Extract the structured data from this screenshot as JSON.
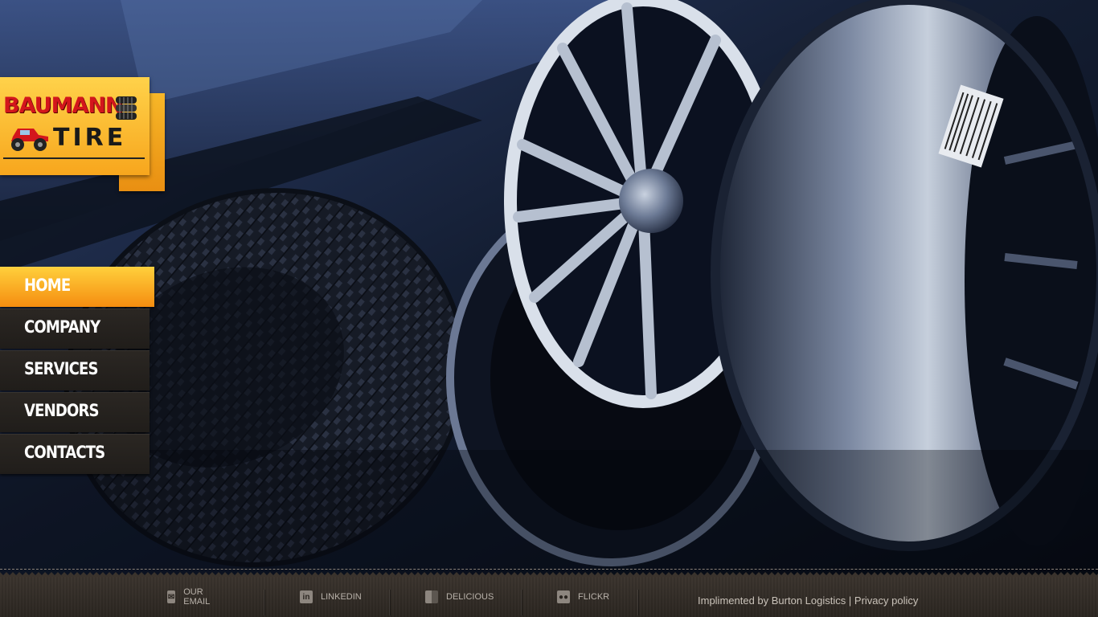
{
  "logo": {
    "line1": "BAUMANN",
    "line2": "TIRE",
    "icons": [
      "monster-truck-icon",
      "tire-stack-icon"
    ]
  },
  "nav": {
    "items": [
      {
        "label": "HOME",
        "active": true
      },
      {
        "label": "COMPANY",
        "active": false
      },
      {
        "label": "SERVICES",
        "active": false
      },
      {
        "label": "VENDORS",
        "active": false
      },
      {
        "label": "CONTACTS",
        "active": false
      }
    ]
  },
  "footer": {
    "social": [
      {
        "label": "OUR EMAIL",
        "icon": "mail-icon"
      },
      {
        "label": "LINKEDIN",
        "icon": "linkedin-icon"
      },
      {
        "label": "DELICIOUS",
        "icon": "delicious-icon"
      },
      {
        "label": "FLICKR",
        "icon": "flickr-icon"
      }
    ],
    "credit_text": "Implimented by Burton Logistics",
    "separator": "|",
    "privacy_label": "Privacy policy"
  },
  "colors": {
    "accent": "#f7a61d",
    "logo_red": "#d3161c",
    "nav_bg": "#2b2723",
    "footer_bg": "#2a2520",
    "hero_bg": "#0d1524"
  }
}
